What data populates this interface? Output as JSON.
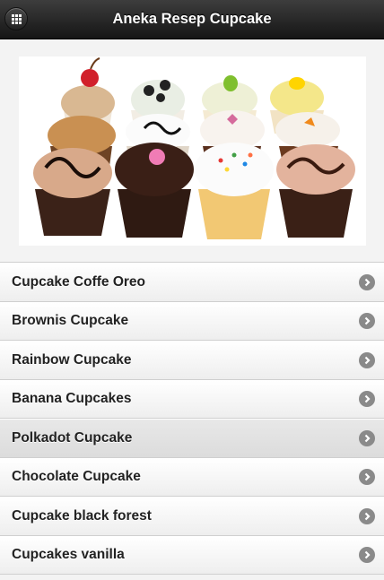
{
  "header": {
    "title": "Aneka Resep Cupcake",
    "menu_icon": "grid-menu-icon"
  },
  "hero": {
    "description_icon": "cupcakes-photo"
  },
  "recipes": [
    {
      "label": "Cupcake Coffe Oreo"
    },
    {
      "label": "Brownis Cupcake"
    },
    {
      "label": "Rainbow Cupcake"
    },
    {
      "label": "Banana Cupcakes"
    },
    {
      "label": "Polkadot Cupcake"
    },
    {
      "label": "Chocolate Cupcake"
    },
    {
      "label": "Cupcake black forest"
    },
    {
      "label": "Cupcakes vanilla"
    }
  ],
  "colors": {
    "header_bg": "#222222",
    "arrow": "#8a8a8a"
  }
}
